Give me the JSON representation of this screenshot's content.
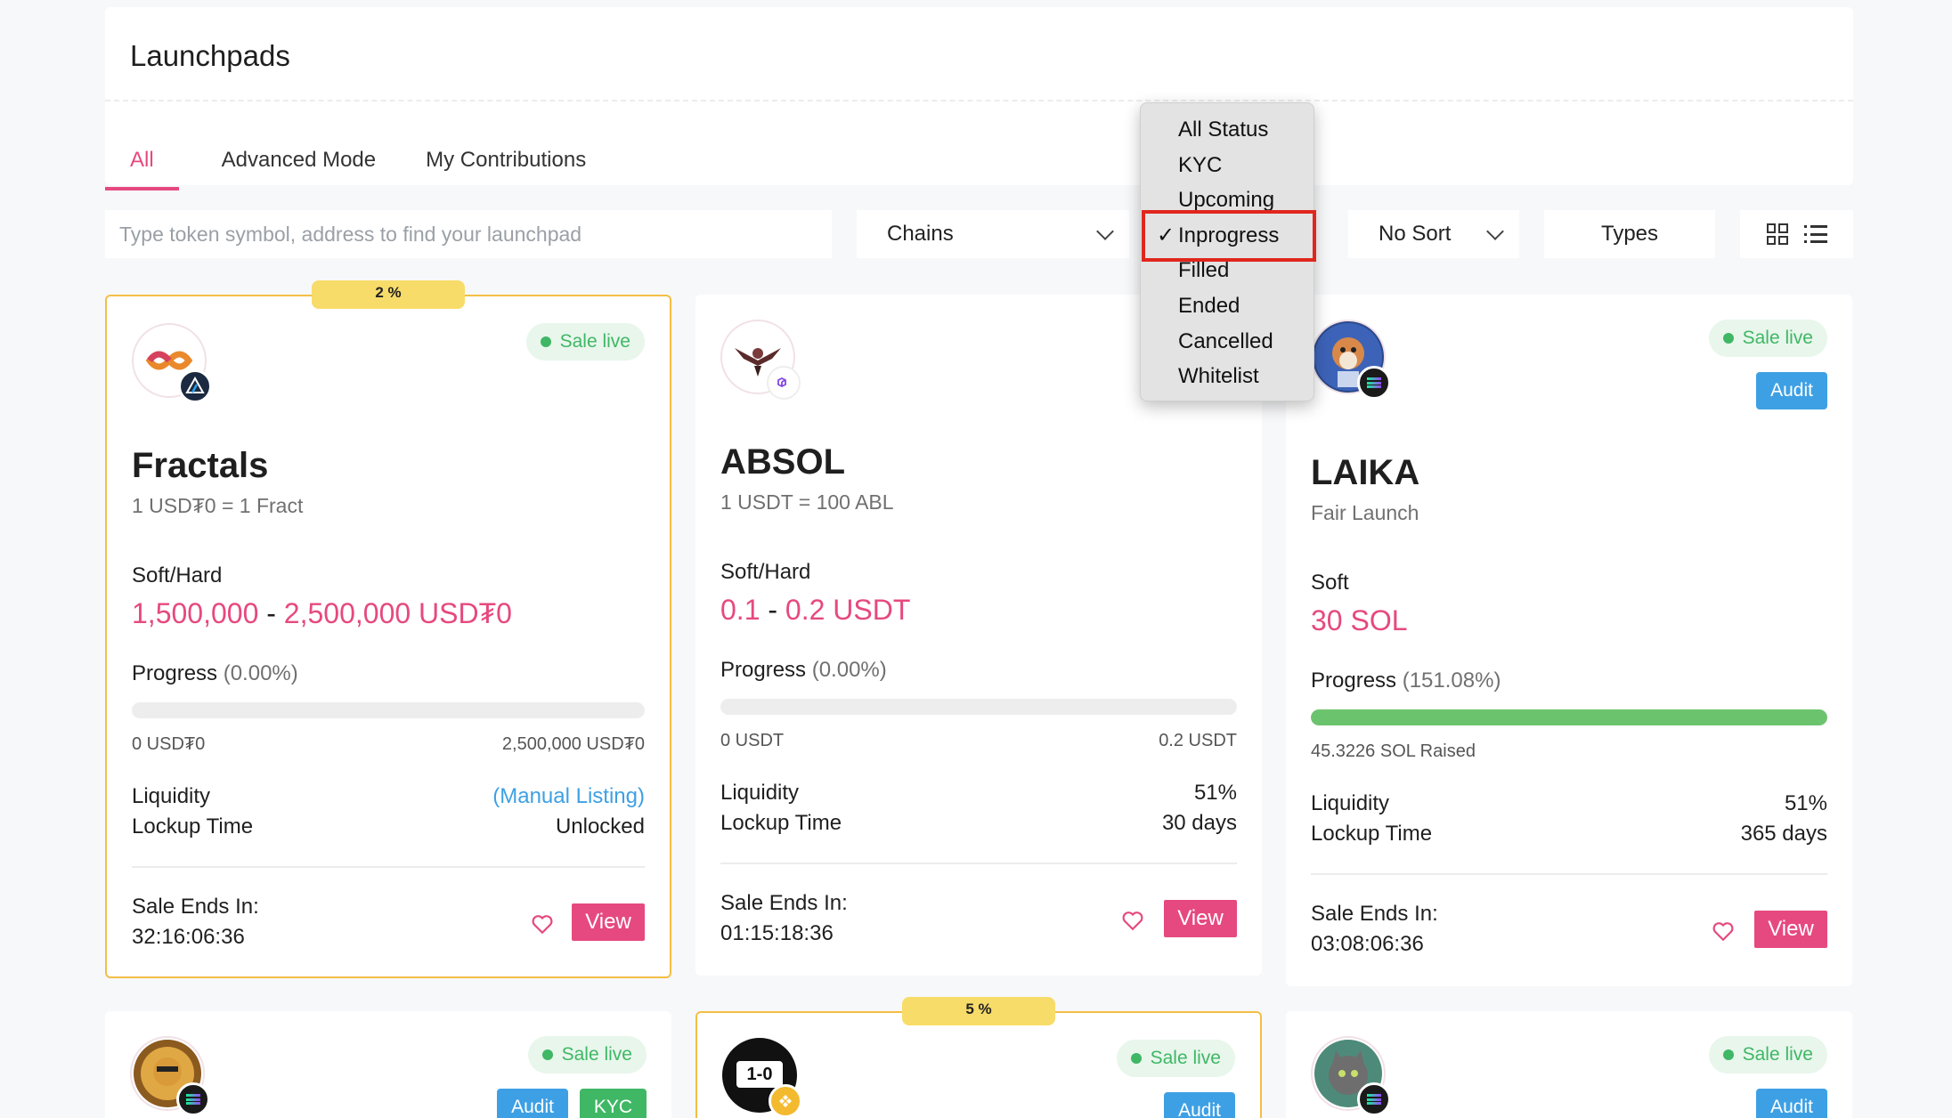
{
  "page": {
    "title": "Launchpads"
  },
  "tabs": [
    {
      "label": "All",
      "active": true
    },
    {
      "label": "Advanced Mode",
      "active": false
    },
    {
      "label": "My Contributions",
      "active": false
    }
  ],
  "filters": {
    "search_placeholder": "Type token symbol, address to find your launchpad",
    "chains": "Chains",
    "sort": "No Sort",
    "types": "Types"
  },
  "status_dropdown": {
    "options": [
      "All Status",
      "KYC",
      "Upcoming",
      "Inprogress",
      "Filled",
      "Ended",
      "Cancelled",
      "Whitelist"
    ],
    "selected": "Inprogress",
    "check": "✓"
  },
  "cards": [
    {
      "featured": true,
      "percent_tag": "2 %",
      "status": "Sale live",
      "name": "Fractals",
      "rate": "1 USD₮0 = 1 Fract",
      "cap_label": "Soft/Hard",
      "soft": "1,500,000",
      "dash": " - ",
      "hard": "2,500,000 USD₮0",
      "progress_label": "Progress",
      "progress_pct": "(0.00%)",
      "progress_value": 0,
      "min_label": "0 USD₮0",
      "max_label": "2,500,000 USD₮0",
      "liquidity_label": "Liquidity",
      "liquidity_value": "(Manual Listing)",
      "lockup_label": "Lockup Time",
      "lockup_value": "Unlocked",
      "ends_label": "Sale Ends In:",
      "ends_value": "32:16:06:36",
      "view": "View"
    },
    {
      "featured": false,
      "status": "Sale live",
      "name": "ABSOL",
      "rate": "1 USDT = 100 ABL",
      "cap_label": "Soft/Hard",
      "soft": "0.1",
      "dash": " - ",
      "hard": "0.2 USDT",
      "progress_label": "Progress",
      "progress_pct": "(0.00%)",
      "progress_value": 0,
      "min_label": "0 USDT",
      "max_label": "0.2 USDT",
      "liquidity_label": "Liquidity",
      "liquidity_value": "51%",
      "lockup_label": "Lockup Time",
      "lockup_value": "30 days",
      "ends_label": "Sale Ends In:",
      "ends_value": "01:15:18:36",
      "view": "View"
    },
    {
      "featured": false,
      "status": "Sale live",
      "audit": "Audit",
      "name": "LAIKA",
      "rate": "Fair Launch",
      "cap_label": "Soft",
      "soft": "30 SOL",
      "progress_label": "Progress",
      "progress_pct": "(151.08%)",
      "progress_value": 1.0,
      "raised_label": "45.3226 SOL Raised",
      "liquidity_label": "Liquidity",
      "liquidity_value": "51%",
      "lockup_label": "Lockup Time",
      "lockup_value": "365 days",
      "ends_label": "Sale Ends In:",
      "ends_value": "03:08:06:36",
      "view": "View"
    },
    {
      "status": "Sale live",
      "audit": "Audit",
      "kyc": "KYC"
    },
    {
      "featured": true,
      "percent_tag": "5 %",
      "status": "Sale live",
      "audit": "Audit",
      "avatar_text": "1-0"
    },
    {
      "status": "Sale live",
      "audit": "Audit"
    }
  ],
  "colors": {
    "accent": "#e6497f",
    "sale_live": "#3fb765",
    "audit": "#3ea0e4",
    "featured_border": "#f4be45",
    "progress_fill": "#6cc36d"
  }
}
